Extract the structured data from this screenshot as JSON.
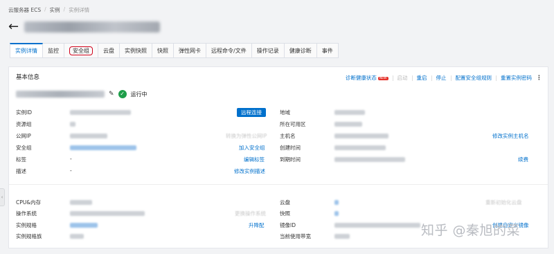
{
  "breadcrumb": {
    "items": [
      "云服务器 ECS",
      "实例",
      "实例详情"
    ]
  },
  "tabs": [
    "实例详情",
    "监控",
    "安全组",
    "云盘",
    "实例快照",
    "快照",
    "弹性网卡",
    "远程命令/文件",
    "操作记录",
    "健康诊断",
    "事件"
  ],
  "card": {
    "title": "基本信息",
    "actions": {
      "diagnose": "诊断健康状态",
      "new_badge": "NEW",
      "start": "启动",
      "restart": "重启",
      "stop": "停止",
      "config_sg": "配置安全组规则",
      "reset_pwd": "重置实例密码"
    },
    "status": "运行中"
  },
  "fields": {
    "instance_id": "实例ID",
    "remote_connect": "远程连接",
    "region": "地域",
    "resource_group": "资源组",
    "zone": "所在可用区",
    "public_ip": "公网IP",
    "convert_eip": "转换为弹性公网IP",
    "hostname": "主机名",
    "modify_hostname": "修改实例主机名",
    "security_group": "安全组",
    "join_sg": "加入安全组",
    "created_at": "创建时间",
    "tags": "标签",
    "tags_value": "-",
    "edit_tags": "编辑标签",
    "auto_release": "自动释放时间",
    "expire": "到期时间",
    "renew": "续费",
    "desc": "描述",
    "desc_value": "-",
    "edit_desc": "修改实例描述",
    "cpu_mem": "CPU&内存",
    "disk": "云盘",
    "reinit_disk": "重新初始化云盘",
    "os": "操作系统",
    "change_os": "更换操作系统",
    "snapshot": "快照",
    "instance_type": "实例规格",
    "upgrade": "升降配",
    "image_id": "镜像ID",
    "create_custom_image": "创建自定义镜像",
    "instance_family": "实例规格族",
    "bandwidth": "当前使用带宽"
  },
  "watermark": "知乎 @秦旭的菜",
  "icons": {
    "back": "back-arrow-icon",
    "edit": "edit-pencil-icon",
    "status": "running-check-icon",
    "more": "more-vertical-icon"
  },
  "colors": {
    "link": "#0070cc",
    "running": "#1e9e4a",
    "badge": "#e5322b",
    "highlight": "#d0021b"
  }
}
